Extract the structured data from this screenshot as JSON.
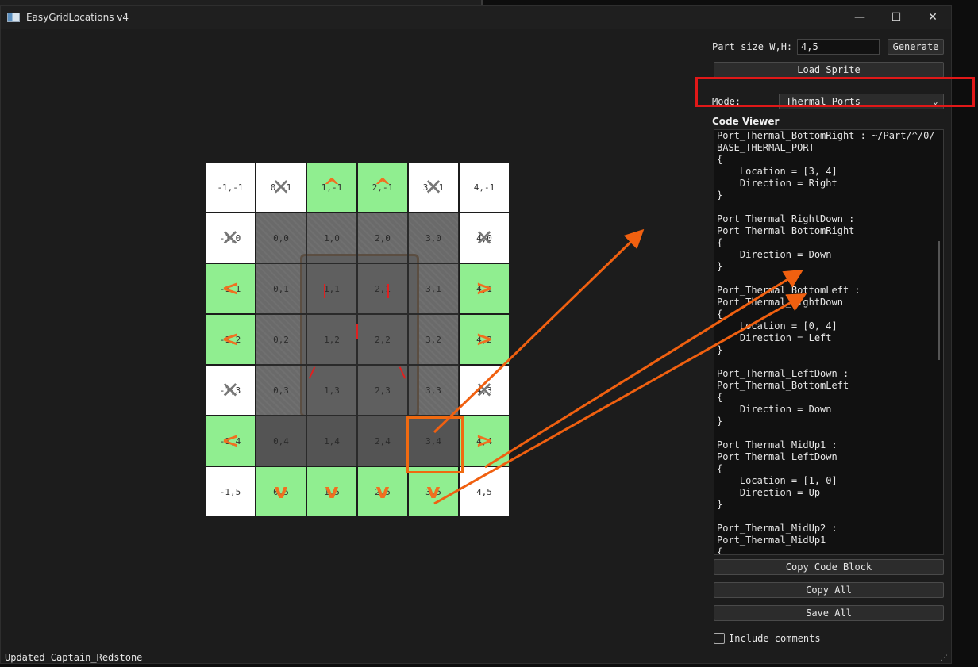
{
  "window": {
    "title": "EasyGridLocations v4"
  },
  "controls": {
    "minimize": "—",
    "maximize": "☐",
    "close": "✕"
  },
  "panel": {
    "part_size_label": "Part size W,H:",
    "part_size_value": "4,5",
    "generate_label": "Generate",
    "load_sprite_label": "Load Sprite",
    "mode_label": "Mode:",
    "mode_value": "Thermal Ports",
    "code_viewer_title": "Code Viewer",
    "code_text": "Port_Thermal_BottomRight : ~/Part/^/0/\nBASE_THERMAL_PORT\n{\n    Location = [3, 4]\n    Direction = Right\n}\n\nPort_Thermal_RightDown :\nPort_Thermal_BottomRight\n{\n    Direction = Down\n}\n\nPort_Thermal_BottomLeft :\nPort_Thermal_RightDown\n{\n    Location = [0, 4]\n    Direction = Left\n}\n\nPort_Thermal_LeftDown :\nPort_Thermal_BottomLeft\n{\n    Direction = Down\n}\n\nPort_Thermal_MidUp1 :\nPort_Thermal_LeftDown\n{\n    Location = [1, 0]\n    Direction = Up\n}\n\nPort_Thermal_MidUp2 :\nPort_Thermal_MidUp1\n{",
    "copy_code_block_label": "Copy Code Block",
    "copy_all_label": "Copy All",
    "save_all_label": "Save All",
    "include_comments_label": "Include comments",
    "include_comments_checked": false
  },
  "status": {
    "text": "Updated Captain_Redstone"
  },
  "grid": {
    "rows": [
      [
        {
          "label": "-1,-1",
          "bg": "white",
          "mark": ""
        },
        {
          "label": "0,-1",
          "bg": "white",
          "mark": "x"
        },
        {
          "label": "1,-1",
          "bg": "green",
          "mark": "up"
        },
        {
          "label": "2,-1",
          "bg": "green",
          "mark": "up"
        },
        {
          "label": "3,-1",
          "bg": "white",
          "mark": "x"
        },
        {
          "label": "4,-1",
          "bg": "white",
          "mark": ""
        }
      ],
      [
        {
          "label": "-1,0",
          "bg": "white",
          "mark": "x"
        },
        {
          "label": "0,0",
          "bg": "sprite",
          "mark": ""
        },
        {
          "label": "1,0",
          "bg": "sprite",
          "mark": ""
        },
        {
          "label": "2,0",
          "bg": "sprite",
          "mark": ""
        },
        {
          "label": "3,0",
          "bg": "sprite",
          "mark": ""
        },
        {
          "label": "4,0",
          "bg": "white",
          "mark": "x"
        }
      ],
      [
        {
          "label": "-1,1",
          "bg": "green",
          "mark": "left"
        },
        {
          "label": "0,1",
          "bg": "sprite",
          "mark": ""
        },
        {
          "label": "1,1",
          "bg": "sprite",
          "mark": ""
        },
        {
          "label": "2,1",
          "bg": "sprite",
          "mark": ""
        },
        {
          "label": "3,1",
          "bg": "sprite",
          "mark": ""
        },
        {
          "label": "4,1",
          "bg": "green",
          "mark": "right"
        }
      ],
      [
        {
          "label": "-1,2",
          "bg": "green",
          "mark": "left"
        },
        {
          "label": "0,2",
          "bg": "sprite",
          "mark": ""
        },
        {
          "label": "1,2",
          "bg": "sprite",
          "mark": ""
        },
        {
          "label": "2,2",
          "bg": "sprite",
          "mark": ""
        },
        {
          "label": "3,2",
          "bg": "sprite",
          "mark": ""
        },
        {
          "label": "4,2",
          "bg": "green",
          "mark": "right"
        }
      ],
      [
        {
          "label": "-1,3",
          "bg": "white",
          "mark": "x"
        },
        {
          "label": "0,3",
          "bg": "sprite",
          "mark": ""
        },
        {
          "label": "1,3",
          "bg": "sprite",
          "mark": ""
        },
        {
          "label": "2,3",
          "bg": "sprite",
          "mark": ""
        },
        {
          "label": "3,3",
          "bg": "sprite",
          "mark": ""
        },
        {
          "label": "4,3",
          "bg": "white",
          "mark": "x"
        }
      ],
      [
        {
          "label": "-1,4",
          "bg": "green",
          "mark": "left"
        },
        {
          "label": "0,4",
          "bg": "sprite",
          "mark": ""
        },
        {
          "label": "1,4",
          "bg": "sprite",
          "mark": ""
        },
        {
          "label": "2,4",
          "bg": "sprite",
          "mark": ""
        },
        {
          "label": "3,4",
          "bg": "sprite",
          "mark": ""
        },
        {
          "label": "4,4",
          "bg": "green",
          "mark": "right"
        }
      ],
      [
        {
          "label": "-1,5",
          "bg": "white",
          "mark": ""
        },
        {
          "label": "0,5",
          "bg": "green",
          "mark": "down"
        },
        {
          "label": "1,5",
          "bg": "green",
          "mark": "down"
        },
        {
          "label": "2,5",
          "bg": "green",
          "mark": "down"
        },
        {
          "label": "3,5",
          "bg": "green",
          "mark": "down"
        },
        {
          "label": "4,5",
          "bg": "white",
          "mark": ""
        }
      ]
    ]
  },
  "colors": {
    "green_cell": "#90ee90",
    "arrow": "#f07020",
    "highlight": "#e01818"
  },
  "icons": {
    "x_mark": "x-mark-icon",
    "up": "up-arrow-icon",
    "down": "down-arrow-icon",
    "left": "left-arrow-icon",
    "right": "right-arrow-icon"
  }
}
